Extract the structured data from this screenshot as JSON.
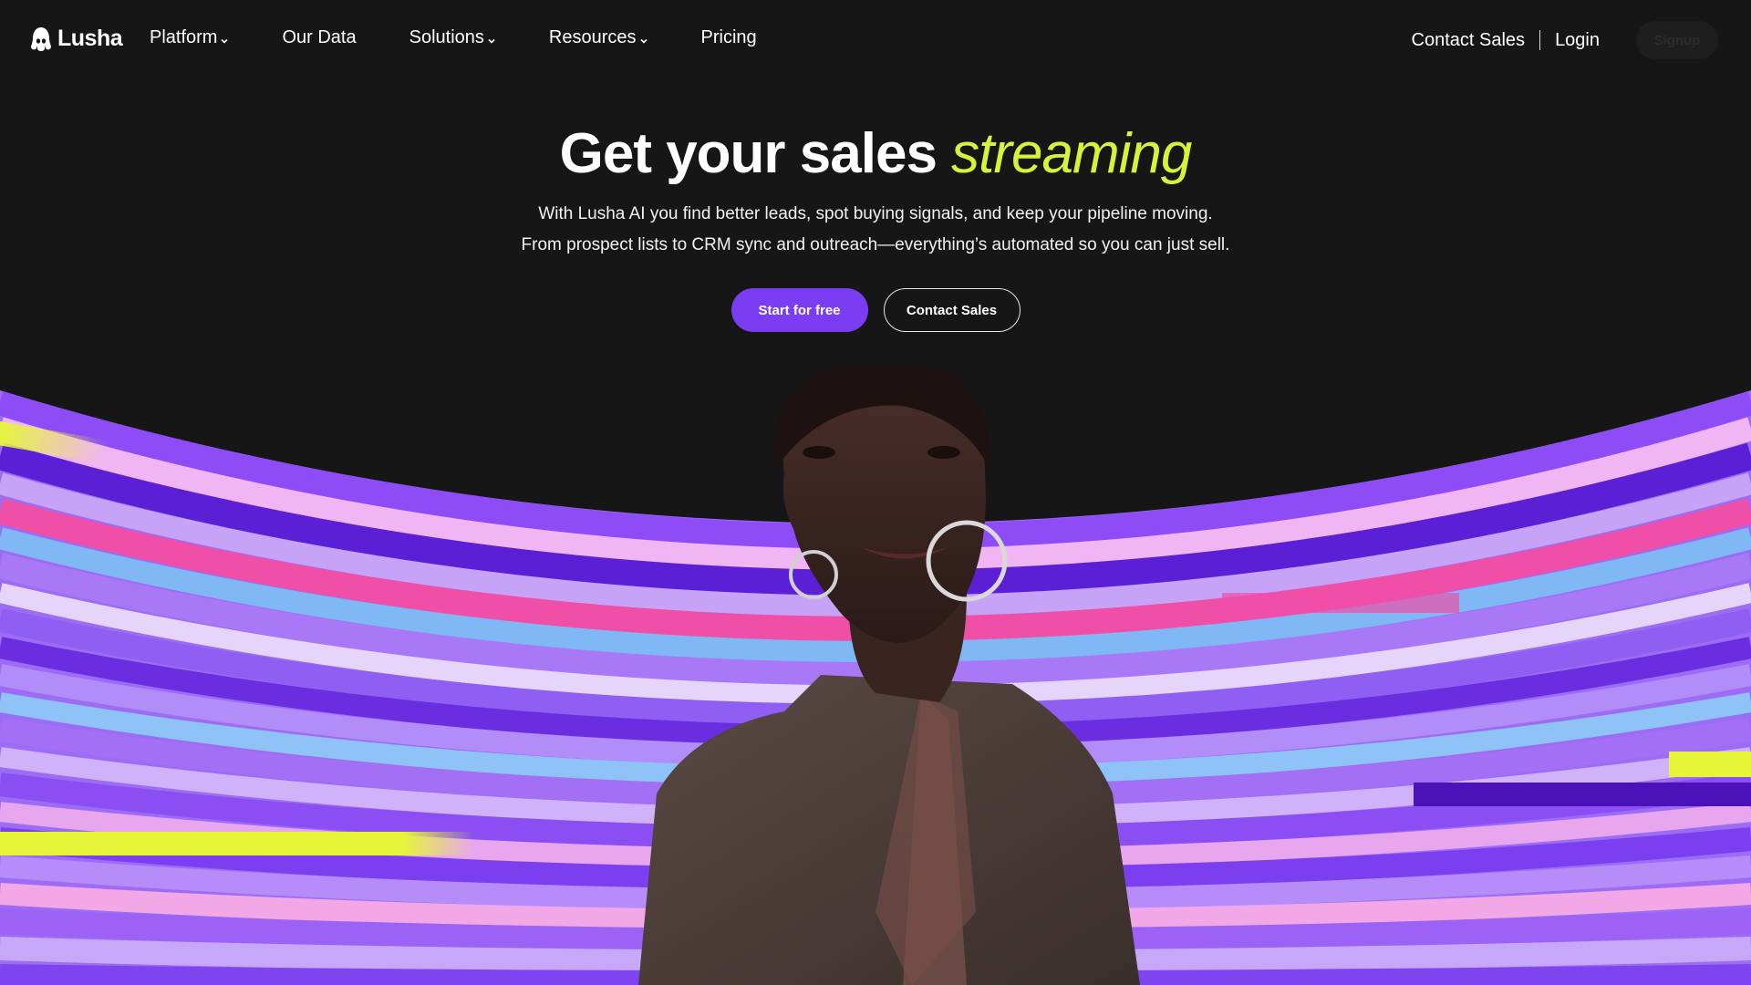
{
  "nav": {
    "logo_text": "Lusha",
    "items": [
      {
        "label": "Platform",
        "has_dropdown": true
      },
      {
        "label": "Our Data",
        "has_dropdown": false
      },
      {
        "label": "Solutions",
        "has_dropdown": true
      },
      {
        "label": "Resources",
        "has_dropdown": true
      },
      {
        "label": "Pricing",
        "has_dropdown": false
      }
    ],
    "contact_sales": "Contact Sales",
    "login": "Login",
    "signup": "Signup"
  },
  "hero": {
    "title_main": "Get your sales",
    "title_accent": "streaming",
    "subtitle_line1": "With Lusha AI you find better leads, spot buying signals, and keep your pipeline moving.",
    "subtitle_line2": "From prospect lists to CRM sync and outreach—everything’s automated so you can just sell.",
    "cta_primary": "Start for free",
    "cta_secondary": "Contact Sales"
  },
  "colors": {
    "background": "#161616",
    "accent_yellow": "#d6f23a",
    "brand_purple": "#7a3df2"
  },
  "icons": {
    "logo": "lusha-logo-icon",
    "dropdown": "chevron-down-icon"
  }
}
